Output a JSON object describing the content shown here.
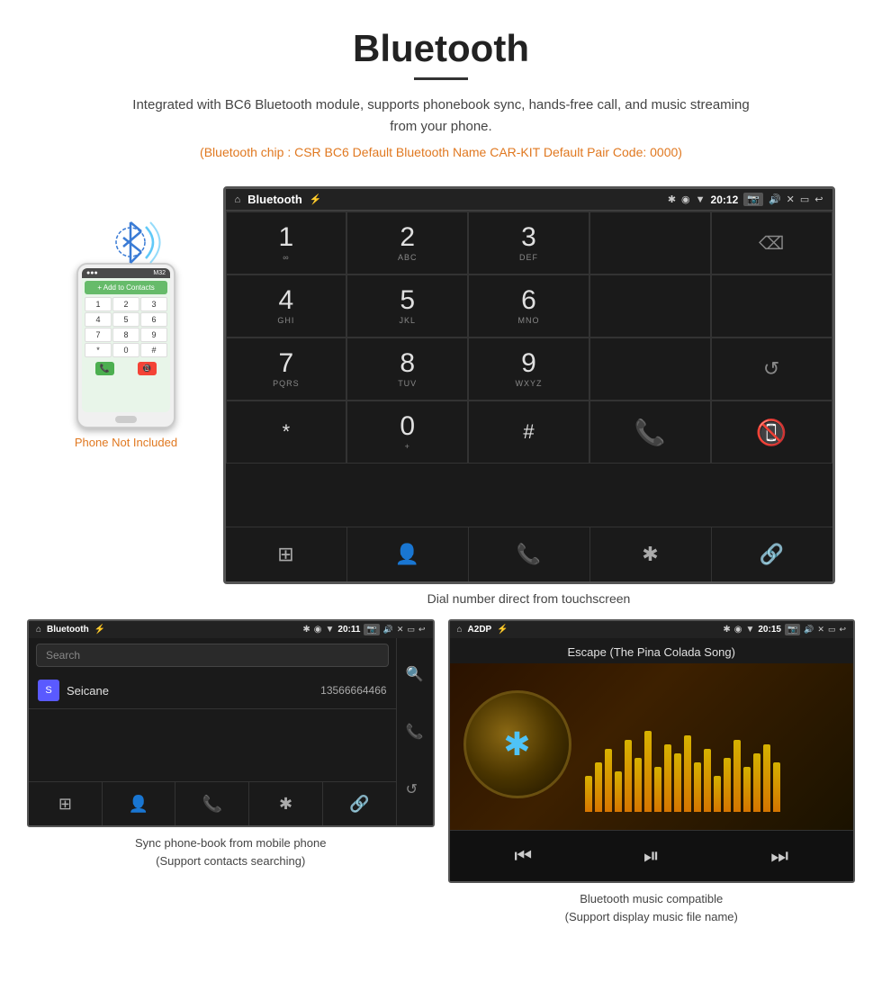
{
  "page": {
    "title": "Bluetooth",
    "subtitle": "Integrated with BC6 Bluetooth module, supports phonebook sync, hands-free call, and music streaming from your phone.",
    "spec_line": "(Bluetooth chip : CSR BC6    Default Bluetooth Name CAR-KIT    Default Pair Code: 0000)",
    "caption_main": "Dial number direct from touchscreen",
    "caption_phonebook": "Sync phone-book from mobile phone\n(Support contacts searching)",
    "caption_music": "Bluetooth music compatible\n(Support display music file name)"
  },
  "statusbar": {
    "title": "Bluetooth",
    "time": "20:12",
    "usb_icon": "⚡",
    "bt_icon": "✱",
    "location_icon": "◉",
    "signal_icon": "▼",
    "camera_icon": "📷",
    "volume_icon": "🔊",
    "close_icon": "✕",
    "screen_icon": "▭",
    "back_icon": "↩"
  },
  "dialpad": {
    "keys": [
      {
        "num": "1",
        "letters": "∞"
      },
      {
        "num": "2",
        "letters": "ABC"
      },
      {
        "num": "3",
        "letters": "DEF"
      },
      {
        "num": "",
        "letters": ""
      },
      {
        "num": "⌫",
        "letters": ""
      },
      {
        "num": "4",
        "letters": "GHI"
      },
      {
        "num": "5",
        "letters": "JKL"
      },
      {
        "num": "6",
        "letters": "MNO"
      },
      {
        "num": "",
        "letters": ""
      },
      {
        "num": "",
        "letters": ""
      },
      {
        "num": "7",
        "letters": "PQRS"
      },
      {
        "num": "8",
        "letters": "TUV"
      },
      {
        "num": "9",
        "letters": "WXYZ"
      },
      {
        "num": "",
        "letters": ""
      },
      {
        "num": "↺",
        "letters": ""
      },
      {
        "num": "*",
        "letters": ""
      },
      {
        "num": "0",
        "letters": "+"
      },
      {
        "num": "#",
        "letters": ""
      },
      {
        "num": "📞",
        "letters": ""
      },
      {
        "num": "📵",
        "letters": ""
      }
    ],
    "bottom_nav": [
      "⊞",
      "👤",
      "📞",
      "✱",
      "🔗"
    ]
  },
  "phonebook": {
    "statusbar_title": "Bluetooth",
    "time": "20:11",
    "search_placeholder": "Search",
    "contact_letter": "S",
    "contact_name": "Seicane",
    "contact_number": "13566664466",
    "bottom_nav": [
      "⊞",
      "👤",
      "📞",
      "✱",
      "🔗"
    ],
    "right_icons": [
      "🔍",
      "📞",
      "↺"
    ]
  },
  "music": {
    "statusbar_title": "A2DP",
    "time": "20:15",
    "song_title": "Escape (The Pina Colada Song)",
    "eq_bars": [
      40,
      55,
      70,
      45,
      80,
      60,
      90,
      50,
      75,
      65,
      85,
      55,
      70,
      40,
      60,
      80,
      50,
      65,
      75,
      55
    ],
    "controls": [
      "⏮",
      "⏯",
      "⏭"
    ]
  },
  "phone_mockup": {
    "not_included": "Phone Not Included",
    "contacts_btn": "+ Add to Contacts",
    "keys": [
      "1",
      "2",
      "3",
      "4",
      "5",
      "6",
      "7",
      "8",
      "9",
      "*",
      "0",
      "#"
    ]
  }
}
